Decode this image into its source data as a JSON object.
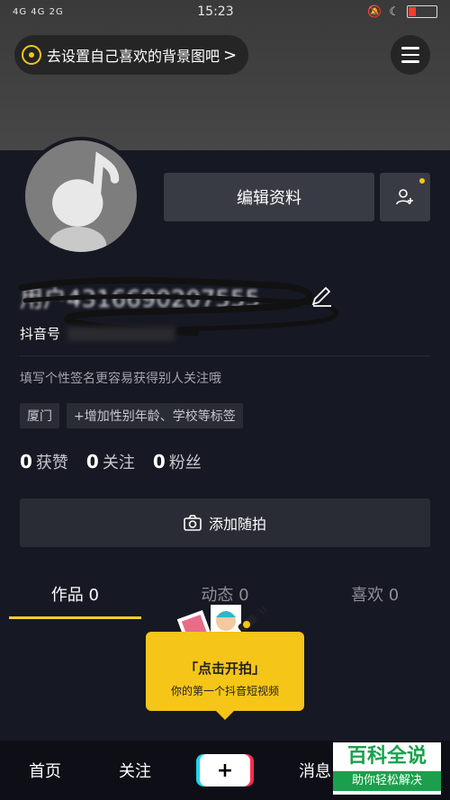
{
  "status_bar": {
    "signal": "4G 4G  2G",
    "time": "15:23"
  },
  "cover": {
    "hint_text": "去设置自己喜欢的背景图吧",
    "hint_chevron": ">"
  },
  "profile": {
    "edit_label": "编辑资料",
    "username": "用户4316690207555",
    "douyin_id_label": "抖音号",
    "bio": "填写个性签名更容易获得别人关注哦",
    "tags": [
      "厦门",
      "+增加性别年龄、学校等标签"
    ]
  },
  "stats": [
    {
      "count": "0",
      "label": "获赞"
    },
    {
      "count": "0",
      "label": "关注"
    },
    {
      "count": "0",
      "label": "粉丝"
    }
  ],
  "shoot_button": {
    "label": "添加随拍",
    "icon": "camera-icon"
  },
  "tabs": [
    {
      "label": "作品 0",
      "active": true
    },
    {
      "label": "动态 0",
      "active": false
    },
    {
      "label": "喜欢 0",
      "active": false
    }
  ],
  "popup": {
    "title": "「点击开拍」",
    "subtitle": "你的第一个抖音短视频"
  },
  "bottom_nav": {
    "home": "首页",
    "follow": "关注",
    "plus": "+",
    "messages": "消息"
  },
  "watermark": {
    "top": "百科全说",
    "bottom": "助你轻松解决"
  },
  "colors": {
    "background": "#161823",
    "accent": "#facd2b",
    "button": "#393b44"
  }
}
